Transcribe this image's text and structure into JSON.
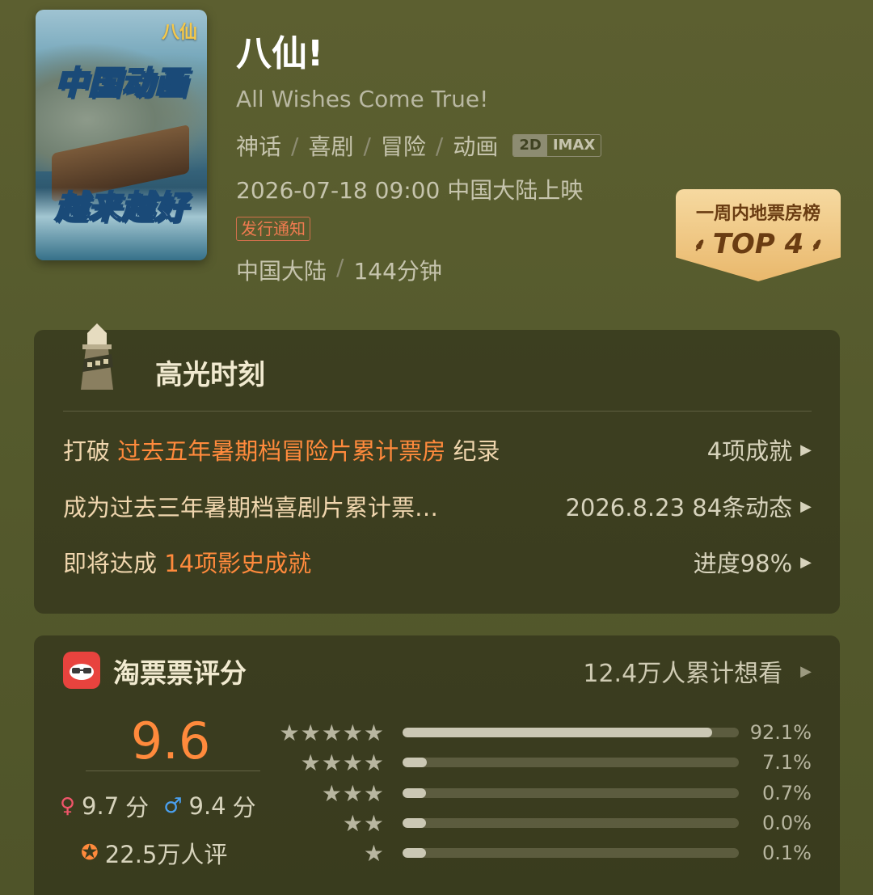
{
  "poster": {
    "logo": "八仙",
    "line1": "中国动画",
    "line2": "越来越好"
  },
  "movie": {
    "title": "八仙!",
    "subtitle": "All Wishes Come True!",
    "genres": [
      "神话",
      "喜剧",
      "冒险",
      "动画"
    ],
    "format_2d": "2D",
    "format_imax": "IMAX",
    "release": "2026-07-18 09:00 中国大陆上映",
    "notice": "发行通知",
    "region": "中国大陆",
    "duration": "144分钟"
  },
  "rank": {
    "label": "一周内地票房榜",
    "top": "TOP 4"
  },
  "highlights": {
    "title": "高光时刻",
    "rows": [
      {
        "pre": "打破 ",
        "hi": "过去五年暑期档冒险片累计票房",
        "post": " 纪录",
        "right": "4项成就"
      },
      {
        "pre": "成为过去三年暑期档喜剧片累计票…",
        "hi": "",
        "post": "",
        "right": "2026.8.23  84条动态"
      },
      {
        "pre": "即将达成 ",
        "hi": "14项影史成就",
        "post": "",
        "right": "进度98%"
      }
    ]
  },
  "rating": {
    "title": "淘票票评分",
    "want": "12.4万人累计想看",
    "score": "9.6",
    "female": "9.7",
    "male": "9.4",
    "unit": "分",
    "count": "22.5万人评",
    "distribution": [
      {
        "stars": 5,
        "pct_label": "92.1%",
        "fraction": 0.921
      },
      {
        "stars": 4,
        "pct_label": "7.1%",
        "fraction": 0.071
      },
      {
        "stars": 3,
        "pct_label": "0.7%",
        "fraction": 0.007
      },
      {
        "stars": 2,
        "pct_label": "0.0%",
        "fraction": 0.0
      },
      {
        "stars": 1,
        "pct_label": "0.1%",
        "fraction": 0.001
      }
    ]
  },
  "colors": {
    "accent_orange": "#ff8a3c",
    "badge_gold": "#e9b86c",
    "taopiao_red": "#e8433e",
    "female_pink": "#f0556a",
    "male_blue": "#4aa0f0"
  }
}
